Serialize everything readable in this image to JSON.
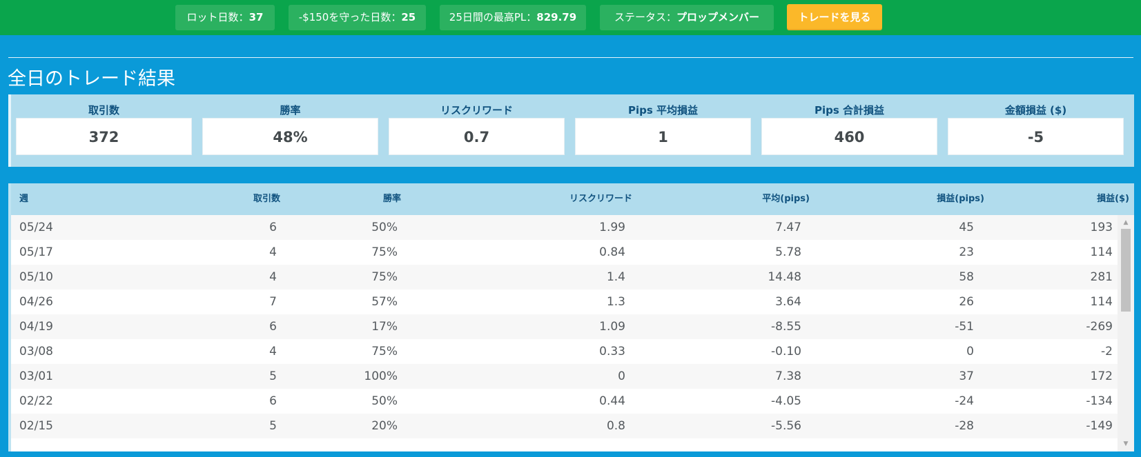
{
  "topbar": {
    "lot_days": {
      "label": "ロット日数：",
      "value": "37"
    },
    "kept_days": {
      "label": "-$150を守った日数：",
      "value": "25"
    },
    "best_pl": {
      "label": "25日間の最高PL：",
      "value": "829.79"
    },
    "status": {
      "label": "ステータス：",
      "value": "プロップメンバー"
    },
    "view_trades_label": "トレードを見る"
  },
  "page_title": "全日のトレード結果",
  "summary": [
    {
      "label": "取引数",
      "value": "372"
    },
    {
      "label": "勝率",
      "value": "48%"
    },
    {
      "label": "リスクリワード",
      "value": "0.7"
    },
    {
      "label": "Pips 平均損益",
      "value": "1"
    },
    {
      "label": "Pips 合計損益",
      "value": "460"
    },
    {
      "label": "金額損益 ($)",
      "value": "-5"
    }
  ],
  "table": {
    "headers": [
      "週",
      "取引数",
      "勝率",
      "リスクリワード",
      "平均(pips)",
      "損益(pips)",
      "損益($)"
    ],
    "rows": [
      [
        "05/24",
        "6",
        "50%",
        "1.99",
        "7.47",
        "45",
        "193"
      ],
      [
        "05/17",
        "4",
        "75%",
        "0.84",
        "5.78",
        "23",
        "114"
      ],
      [
        "05/10",
        "4",
        "75%",
        "1.4",
        "14.48",
        "58",
        "281"
      ],
      [
        "04/26",
        "7",
        "57%",
        "1.3",
        "3.64",
        "26",
        "114"
      ],
      [
        "04/19",
        "6",
        "17%",
        "1.09",
        "-8.55",
        "-51",
        "-269"
      ],
      [
        "03/08",
        "4",
        "75%",
        "0.33",
        "-0.10",
        "0",
        "-2"
      ],
      [
        "03/01",
        "5",
        "100%",
        "0",
        "7.38",
        "37",
        "172"
      ],
      [
        "02/22",
        "6",
        "50%",
        "0.44",
        "-4.05",
        "-24",
        "-134"
      ],
      [
        "02/15",
        "5",
        "20%",
        "0.8",
        "-5.56",
        "-28",
        "-149"
      ]
    ]
  },
  "colors": {
    "topbar_bg": "#0aa54c",
    "page_bg": "#0a9ad8",
    "accent_button": "#fbb829",
    "header_bg": "#b1dced",
    "header_text": "#10527f"
  },
  "scrollbar": {
    "up_icon": "scroll-up-arrow-icon",
    "down_icon": "scroll-down-arrow-icon"
  }
}
